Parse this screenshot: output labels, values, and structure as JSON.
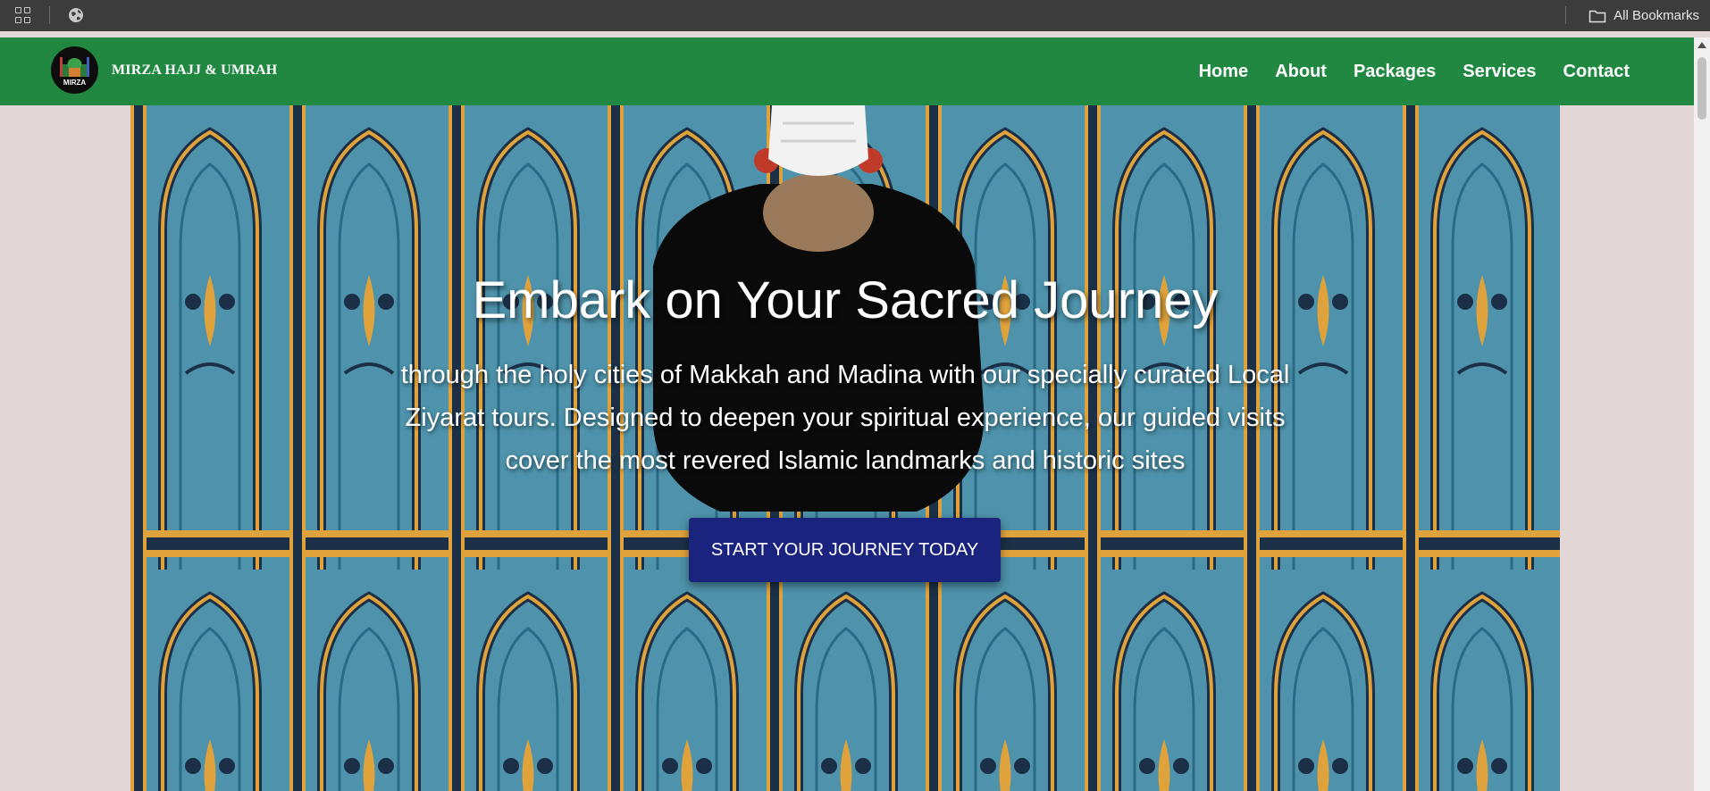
{
  "browser": {
    "bookmarks_label": "All Bookmarks"
  },
  "site": {
    "brand": "MIRZA HAJJ & UMRAH",
    "logo_text": "MIRZA",
    "nav": [
      {
        "label": "Home"
      },
      {
        "label": "About"
      },
      {
        "label": "Packages"
      },
      {
        "label": "Services"
      },
      {
        "label": "Contact"
      }
    ]
  },
  "hero": {
    "title": "Embark on Your Sacred Journey",
    "text": "through the holy cities of Makkah and Madina with our specially curated Local Ziyarat tours. Designed to deepen your spiritual experience, our guided visits cover the most revered Islamic landmarks and historic sites",
    "cta_label": "START YOUR JOURNEY TODAY"
  },
  "colors": {
    "nav_green": "#218841",
    "cta_navy": "#1a237e",
    "carpet_blue": "#4a8fa7",
    "carpet_gold": "#e0a23a",
    "page_bg": "#e2d6d6"
  },
  "icons": [
    "apps-grid-icon",
    "globe-icon",
    "folder-icon",
    "scroll-up-arrow-icon"
  ]
}
